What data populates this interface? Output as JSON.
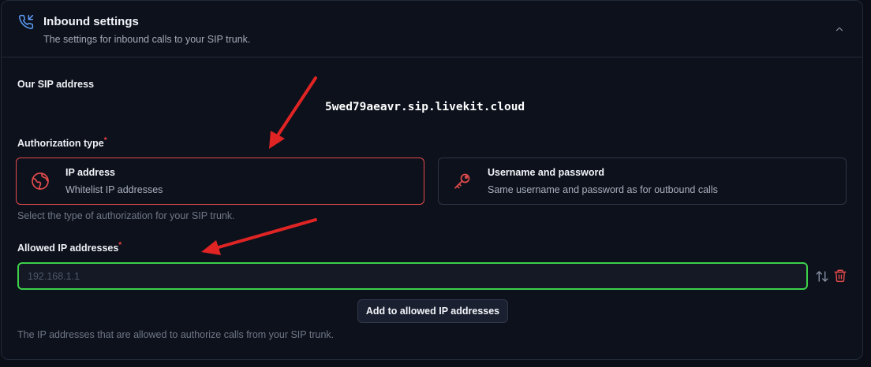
{
  "header": {
    "title": "Inbound settings",
    "subtitle": "The settings for inbound calls to your SIP trunk."
  },
  "sip": {
    "label": "Our SIP address",
    "address": "5wed79aeavr.sip.livekit.cloud"
  },
  "auth": {
    "label": "Authorization type",
    "required_mark": "*",
    "options": [
      {
        "title": "IP address",
        "description": "Whitelist IP addresses",
        "selected": true,
        "icon": "globe-icon"
      },
      {
        "title": "Username and password",
        "description": "Same username and password as for outbound calls",
        "selected": false,
        "icon": "key-icon"
      }
    ],
    "hint": "Select the type of authorization for your SIP trunk."
  },
  "allowed_ips": {
    "label": "Allowed IP addresses",
    "required_mark": "*",
    "placeholder": "192.168.1.1",
    "value": "",
    "add_button_label": "Add to allowed IP addresses",
    "hint": "The IP addresses that are allowed to authorize calls from your SIP trunk."
  },
  "colors": {
    "accent_red": "#e24b4b",
    "input_focus_green": "#3dd14b",
    "annotation_arrow": "#e02424"
  }
}
